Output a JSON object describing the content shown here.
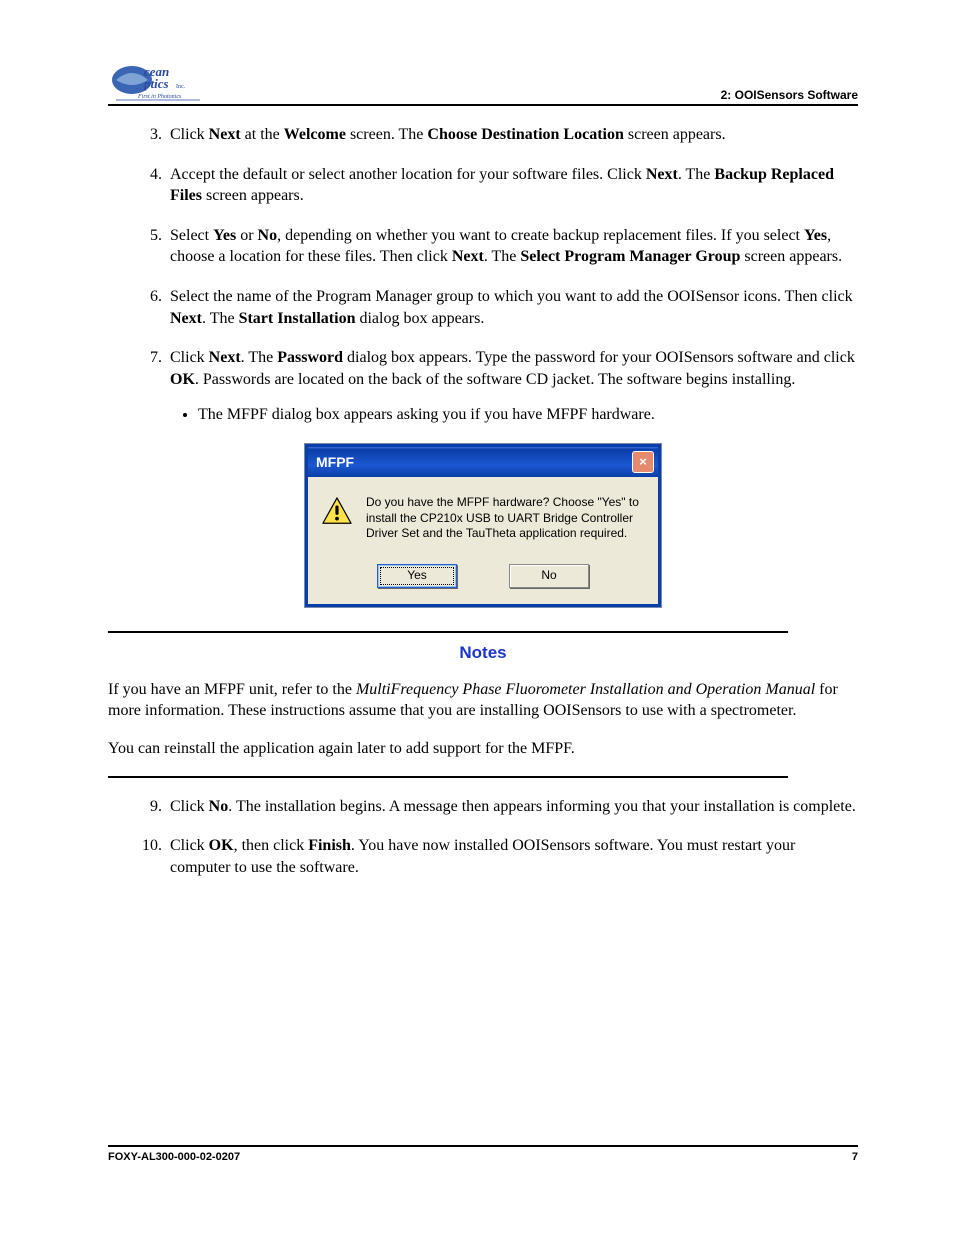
{
  "header": {
    "section": "2: OOISensors Software"
  },
  "steps": {
    "s3": {
      "t1": "Click ",
      "b1": "Next",
      "t2": " at the ",
      "b2": "Welcome",
      "t3": " screen. The ",
      "b3": "Choose Destination Location",
      "t4": " screen appears."
    },
    "s4": {
      "t1": "Accept the default or select another location for your software files. Click ",
      "b1": "Next",
      "t2": ". The ",
      "b2": "Backup Replaced Files",
      "t3": " screen appears."
    },
    "s5": {
      "t1": "Select ",
      "b1": "Yes",
      "t2": " or ",
      "b2": "No",
      "t3": ", depending on whether you want to create backup replacement files. If you select ",
      "b3": "Yes",
      "t4": ", choose a location for these files. Then click ",
      "b4": "Next",
      "t5": ". The ",
      "b5": "Select Program Manager Group",
      "t6": " screen appears."
    },
    "s6": {
      "t1": "Select the name of the Program Manager group to which you want to add the OOISensor icons. Then click ",
      "b1": "Next",
      "t2": ". The ",
      "b2": "Start Installation",
      "t3": " dialog box appears."
    },
    "s7": {
      "t1": "Click ",
      "b1": "Next",
      "t2": ". The ",
      "b2": "Password",
      "t3": " dialog box appears. Type the password for your OOISensors software and click ",
      "b3": "OK",
      "t4": ". Passwords are located on the back of the software CD jacket. The software begins installing."
    },
    "s7bullet": "The MFPF dialog box appears asking you if you have MFPF hardware.",
    "s9": {
      "t1": "Click ",
      "b1": "No",
      "t2": ". The installation begins. A message then appears informing you that your installation is complete."
    },
    "s10": {
      "t1": "Click ",
      "b1": "OK",
      "t2": ", then click ",
      "b2": "Finish",
      "t3": ". You have now installed OOISensors software. You must restart your computer to use the software."
    }
  },
  "dialog": {
    "title": "MFPF",
    "message": "Do you have the MFPF hardware?  Choose \"Yes\" to install the CP210x USB to UART Bridge Controller Driver Set and the TauTheta application required.",
    "yes": "Yes",
    "no": "No",
    "close": "×"
  },
  "notes": {
    "title": "Notes",
    "p1a": "If you have an MFPF unit, refer to the ",
    "p1i": "MultiFrequency Phase Fluorometer Installation and Operation Manual",
    "p1b": " for more information. These instructions assume that you are installing OOISensors to use with a spectrometer.",
    "p2": "You can reinstall the application again later to add support for the MFPF."
  },
  "footer": {
    "doc": "FOXY-AL300-000-02-0207",
    "page": "7"
  }
}
